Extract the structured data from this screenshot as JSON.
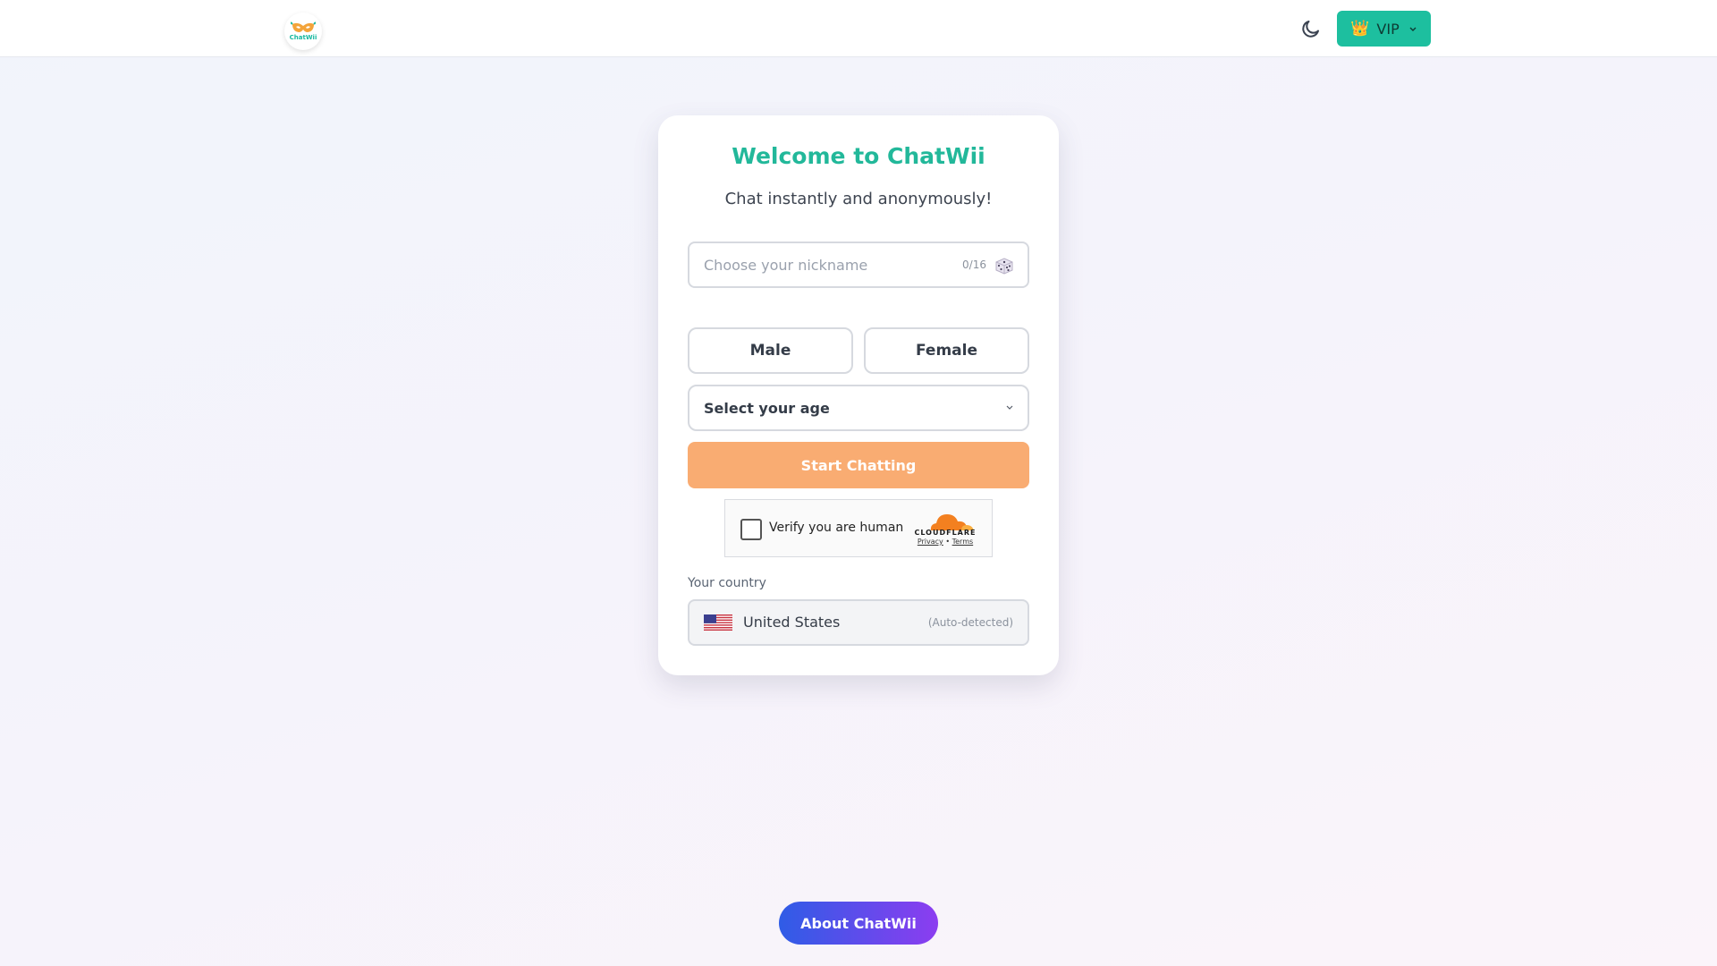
{
  "header": {
    "logo_text": "ChatWii",
    "theme_icon": "moon-icon",
    "vip": {
      "label": "VIP",
      "icon": "crown-icon"
    }
  },
  "welcome": {
    "title": "Welcome to ChatWii",
    "subtitle": "Chat instantly and anonymously!"
  },
  "form": {
    "nickname": {
      "value": "",
      "placeholder": "Choose your nickname",
      "counter": "0/16",
      "icon": "dice-icon"
    },
    "gender": {
      "male_label": "Male",
      "female_label": "Female"
    },
    "age": {
      "placeholder": "Select your age"
    },
    "start_label": "Start Chatting"
  },
  "captcha": {
    "label": "Verify you are human",
    "brand": "CLOUDFLARE",
    "privacy": "Privacy",
    "separator": "•",
    "terms": "Terms"
  },
  "country": {
    "label": "Your country",
    "name": "United States",
    "note": "(Auto-detected)"
  },
  "footer": {
    "about_label": "About ChatWii"
  },
  "colors": {
    "accent": "#1dbf9f",
    "title": "#22b89a",
    "start_button": "#f9ac72",
    "about_gradient_start": "#2f5ce6",
    "about_gradient_end": "#8c3df0"
  }
}
